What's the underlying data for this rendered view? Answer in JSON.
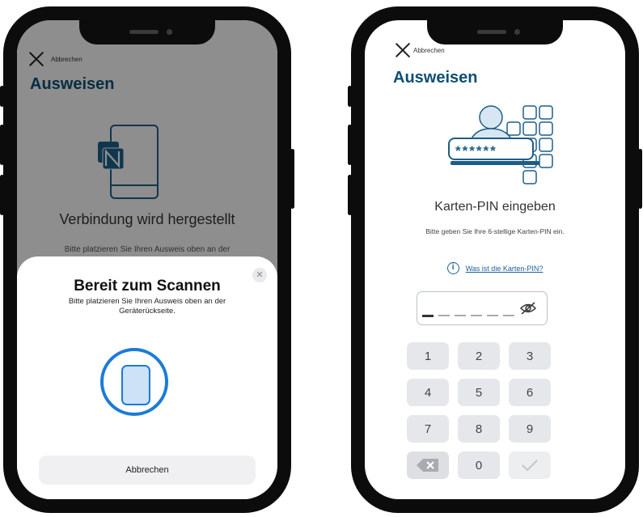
{
  "left_screen": {
    "cancel_label": "Abbrechen",
    "title": "Ausweisen",
    "heading": "Verbindung wird hergestellt",
    "subtext": "Bitte platzieren Sie Ihren Ausweis oben an der",
    "scan_sheet": {
      "title": "Bereit zum Scannen",
      "subtitle": "Bitte platzieren Sie Ihren Ausweis oben an der Geräterückseite.",
      "close_glyph": "✕",
      "button_label": "Abbrechen"
    }
  },
  "right_screen": {
    "cancel_label": "Abbrechen",
    "title": "Ausweisen",
    "illustration_pin": "******",
    "heading": "Karten-PIN eingeben",
    "subtext": "Bitte geben Sie Ihre 6-stellige Karten-PIN ein.",
    "info_glyph": "i",
    "info_link": "Was ist die Karten-PIN?",
    "pin_slot_count": 6,
    "keypad": [
      "1",
      "2",
      "3",
      "4",
      "5",
      "6",
      "7",
      "8",
      "9",
      "",
      "0",
      ""
    ]
  },
  "colors": {
    "title_blue": "#0d4f74",
    "accent_blue": "#1b7bd9",
    "link_blue": "#1b5f9a"
  }
}
